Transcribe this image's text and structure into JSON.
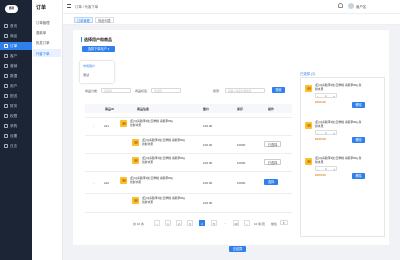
{
  "app": {
    "logo": "德利"
  },
  "sidebar": {
    "items": [
      {
        "label": "首页"
      },
      {
        "label": "商品"
      },
      {
        "label": "订单"
      },
      {
        "label": "客户"
      },
      {
        "label": "营销"
      },
      {
        "label": "数据"
      },
      {
        "label": "用户"
      },
      {
        "label": "配送"
      },
      {
        "label": "财务"
      },
      {
        "label": "权限"
      },
      {
        "label": "采购"
      },
      {
        "label": "设置"
      },
      {
        "label": "日志"
      }
    ]
  },
  "subnav": {
    "title": "订单",
    "items": [
      {
        "label": "订单管理"
      },
      {
        "label": "退款单"
      },
      {
        "label": "批发订单"
      },
      {
        "label": "代客下单"
      }
    ]
  },
  "topbar": {
    "breadcrumb": "订单 / 代客下单",
    "user": "用户名"
  },
  "tabs": [
    {
      "label": "订单管理"
    },
    {
      "label": "商品列表"
    }
  ],
  "section": {
    "title": "选择用户和商品",
    "select_label": "选择下单用户 ▾"
  },
  "dropdown": {
    "items": [
      "市场用户",
      "测试"
    ]
  },
  "filters": {
    "category_label": "商品分类:",
    "category_placeholder": "请选择",
    "brand_label": "商品标签:",
    "brand_placeholder": "请选择",
    "search_label": "搜索:",
    "search_placeholder": "请输入商品名称搜索",
    "search_button": "搜索"
  },
  "table": {
    "headers": [
      "商品ID",
      "商品信息",
      "售价",
      "库存",
      "操作"
    ],
    "rows": [
      {
        "id": "241",
        "name": "[四川]青脆李3处 四季桃 青脆李80g 新鲜水果",
        "price": "100.00",
        "stock": "",
        "action": ""
      },
      {
        "id": "",
        "name": "[四川]青脆李3处 四季桃 青脆李80g 新鲜水果",
        "price": "100.00",
        "stock": "10000",
        "action": "已选择"
      },
      {
        "id": "",
        "name": "[四川]青脆李3处 四季桃 青脆李80g 新鲜水果",
        "price": "100.00",
        "stock": "10000",
        "action": "已选择"
      },
      {
        "id": "242",
        "name": "[四川]青脆李3处 四季桃 青脆李80g 新鲜水果",
        "price": "100.00",
        "stock": "10000",
        "action": "选择"
      },
      {
        "id": "",
        "name": "[四川]青脆李3处 四季桃 青脆李80g 新鲜水果",
        "price": "100.00",
        "stock": "",
        "action": ""
      }
    ]
  },
  "pagination": {
    "total": "共 10 条",
    "pages": [
      "1",
      "2",
      "3",
      "4",
      "5",
      "...",
      "10"
    ],
    "current": "4",
    "page_size": "10 条/页",
    "goto": "前往",
    "goto_value": "5"
  },
  "cart": {
    "title": "已选择 (2)",
    "items": [
      {
        "name": "[四川]青脆李3处 四季桃 青脆李80g 新鲜水果",
        "price": "¥100.00",
        "qty": "1",
        "button": "移除"
      },
      {
        "name": "[四川]青脆李3处 四季桃 青脆李80g 新鲜水果",
        "price": "¥100.00",
        "qty": "1",
        "button": "移除"
      },
      {
        "name": "[四川]青脆李3处 四季桃 青脆李80g 新鲜水果",
        "price": "¥100.00",
        "qty": "1",
        "button": "移除"
      }
    ]
  },
  "footer": {
    "submit": "去结算"
  }
}
